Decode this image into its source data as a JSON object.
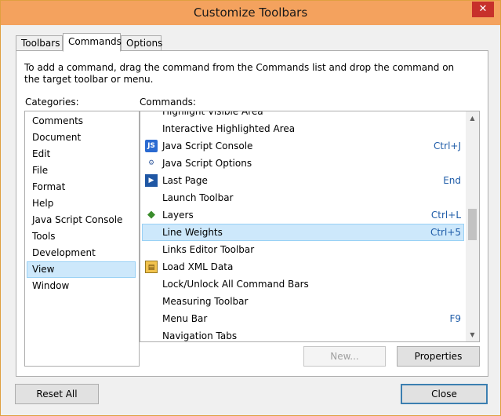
{
  "window": {
    "title": "Customize Toolbars",
    "close_label": "✕"
  },
  "tabs": [
    {
      "label": "Toolbars",
      "active": false
    },
    {
      "label": "Commands",
      "active": true
    },
    {
      "label": "Options",
      "active": false
    }
  ],
  "instructions": "To add a command, drag the command from the Commands list and drop the command on the target toolbar or menu.",
  "categories": {
    "label": "Categories:",
    "items": [
      "Comments",
      "Document",
      "Edit",
      "File",
      "Format",
      "Help",
      "Java Script Console",
      "Tools",
      "Development",
      "View",
      "Window"
    ],
    "selected": "View"
  },
  "commands": {
    "label": "Commands:",
    "items": [
      {
        "label": "Highlight Visible Area",
        "shortcut": "",
        "icon": ""
      },
      {
        "label": "Interactive Highlighted Area",
        "shortcut": "",
        "icon": ""
      },
      {
        "label": "Java Script Console",
        "shortcut": "Ctrl+J",
        "icon": "javascript-console-icon"
      },
      {
        "label": "Java Script Options",
        "shortcut": "",
        "icon": "javascript-options-icon"
      },
      {
        "label": "Last Page",
        "shortcut": "End",
        "icon": "last-page-icon"
      },
      {
        "label": "Launch Toolbar",
        "shortcut": "",
        "icon": ""
      },
      {
        "label": "Layers",
        "shortcut": "Ctrl+L",
        "icon": "layers-icon"
      },
      {
        "label": "Line Weights",
        "shortcut": "Ctrl+5",
        "icon": ""
      },
      {
        "label": "Links Editor Toolbar",
        "shortcut": "",
        "icon": ""
      },
      {
        "label": "Load XML Data",
        "shortcut": "",
        "icon": "load-xml-icon"
      },
      {
        "label": "Lock/Unlock All Command Bars",
        "shortcut": "",
        "icon": ""
      },
      {
        "label": "Measuring Toolbar",
        "shortcut": "",
        "icon": ""
      },
      {
        "label": "Menu Bar",
        "shortcut": "F9",
        "icon": ""
      },
      {
        "label": "Navigation Tabs",
        "shortcut": "",
        "icon": ""
      }
    ],
    "selected": "Line Weights"
  },
  "buttons": {
    "new": "New...",
    "properties": "Properties",
    "reset_all": "Reset All",
    "close": "Close"
  }
}
